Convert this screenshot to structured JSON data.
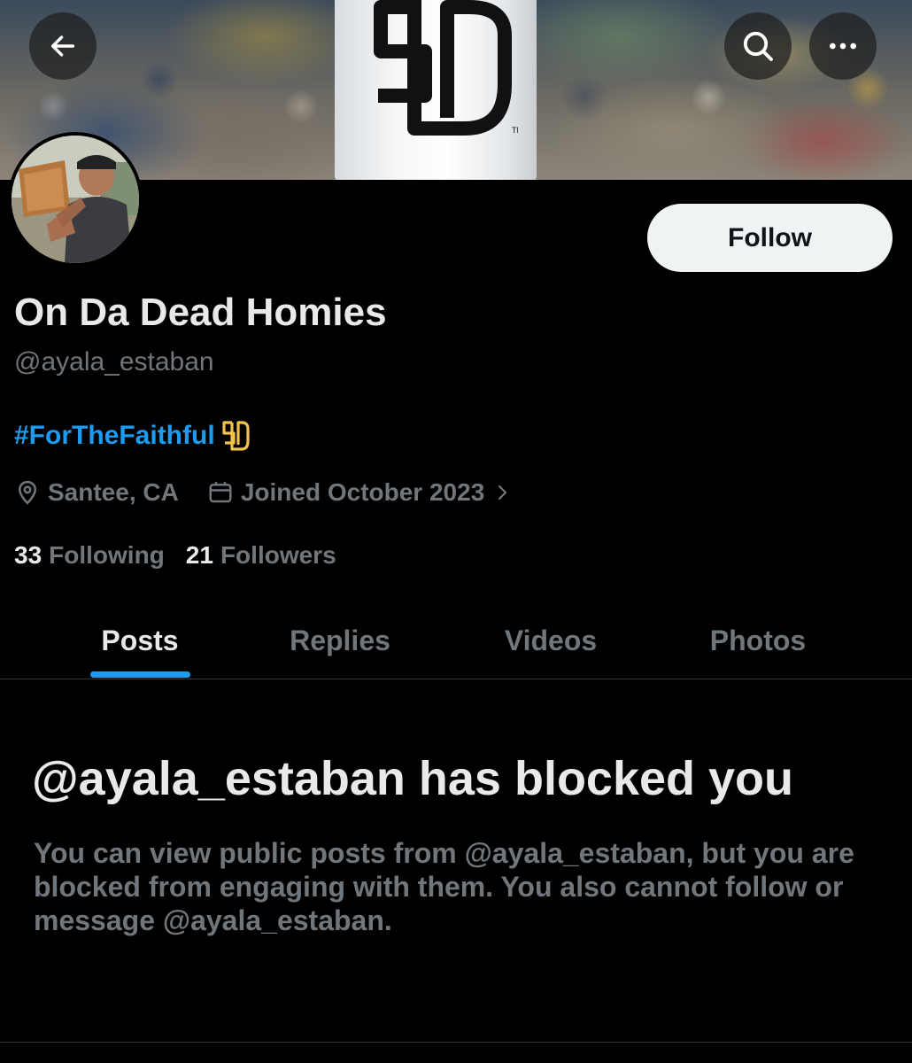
{
  "header": {
    "back_icon": "arrow-left-icon",
    "search_icon": "search-icon",
    "more_icon": "more-horizontal-icon"
  },
  "profile": {
    "display_name": "On Da Dead Homies",
    "handle": "@ayala_estaban",
    "bio_hashtag": "#ForTheFaithful",
    "location": "Santee, CA",
    "joined": "Joined October 2023",
    "follow_label": "Follow",
    "following_count": "33",
    "following_label": "Following",
    "followers_count": "21",
    "followers_label": "Followers"
  },
  "tabs": [
    {
      "label": "Posts",
      "active": true
    },
    {
      "label": "Replies",
      "active": false
    },
    {
      "label": "Videos",
      "active": false
    },
    {
      "label": "Photos",
      "active": false
    }
  ],
  "blocked": {
    "title": "@ayala_estaban has blocked you",
    "message": "You can view public posts from @ayala_estaban, but you are blocked from engaging with them. You also cannot follow or message @ayala_estaban."
  },
  "colors": {
    "background": "#000000",
    "accent": "#1d9bf0",
    "text_primary": "#e7e9ea",
    "text_secondary": "#71767b",
    "padres_gold": "#f2c14e"
  }
}
